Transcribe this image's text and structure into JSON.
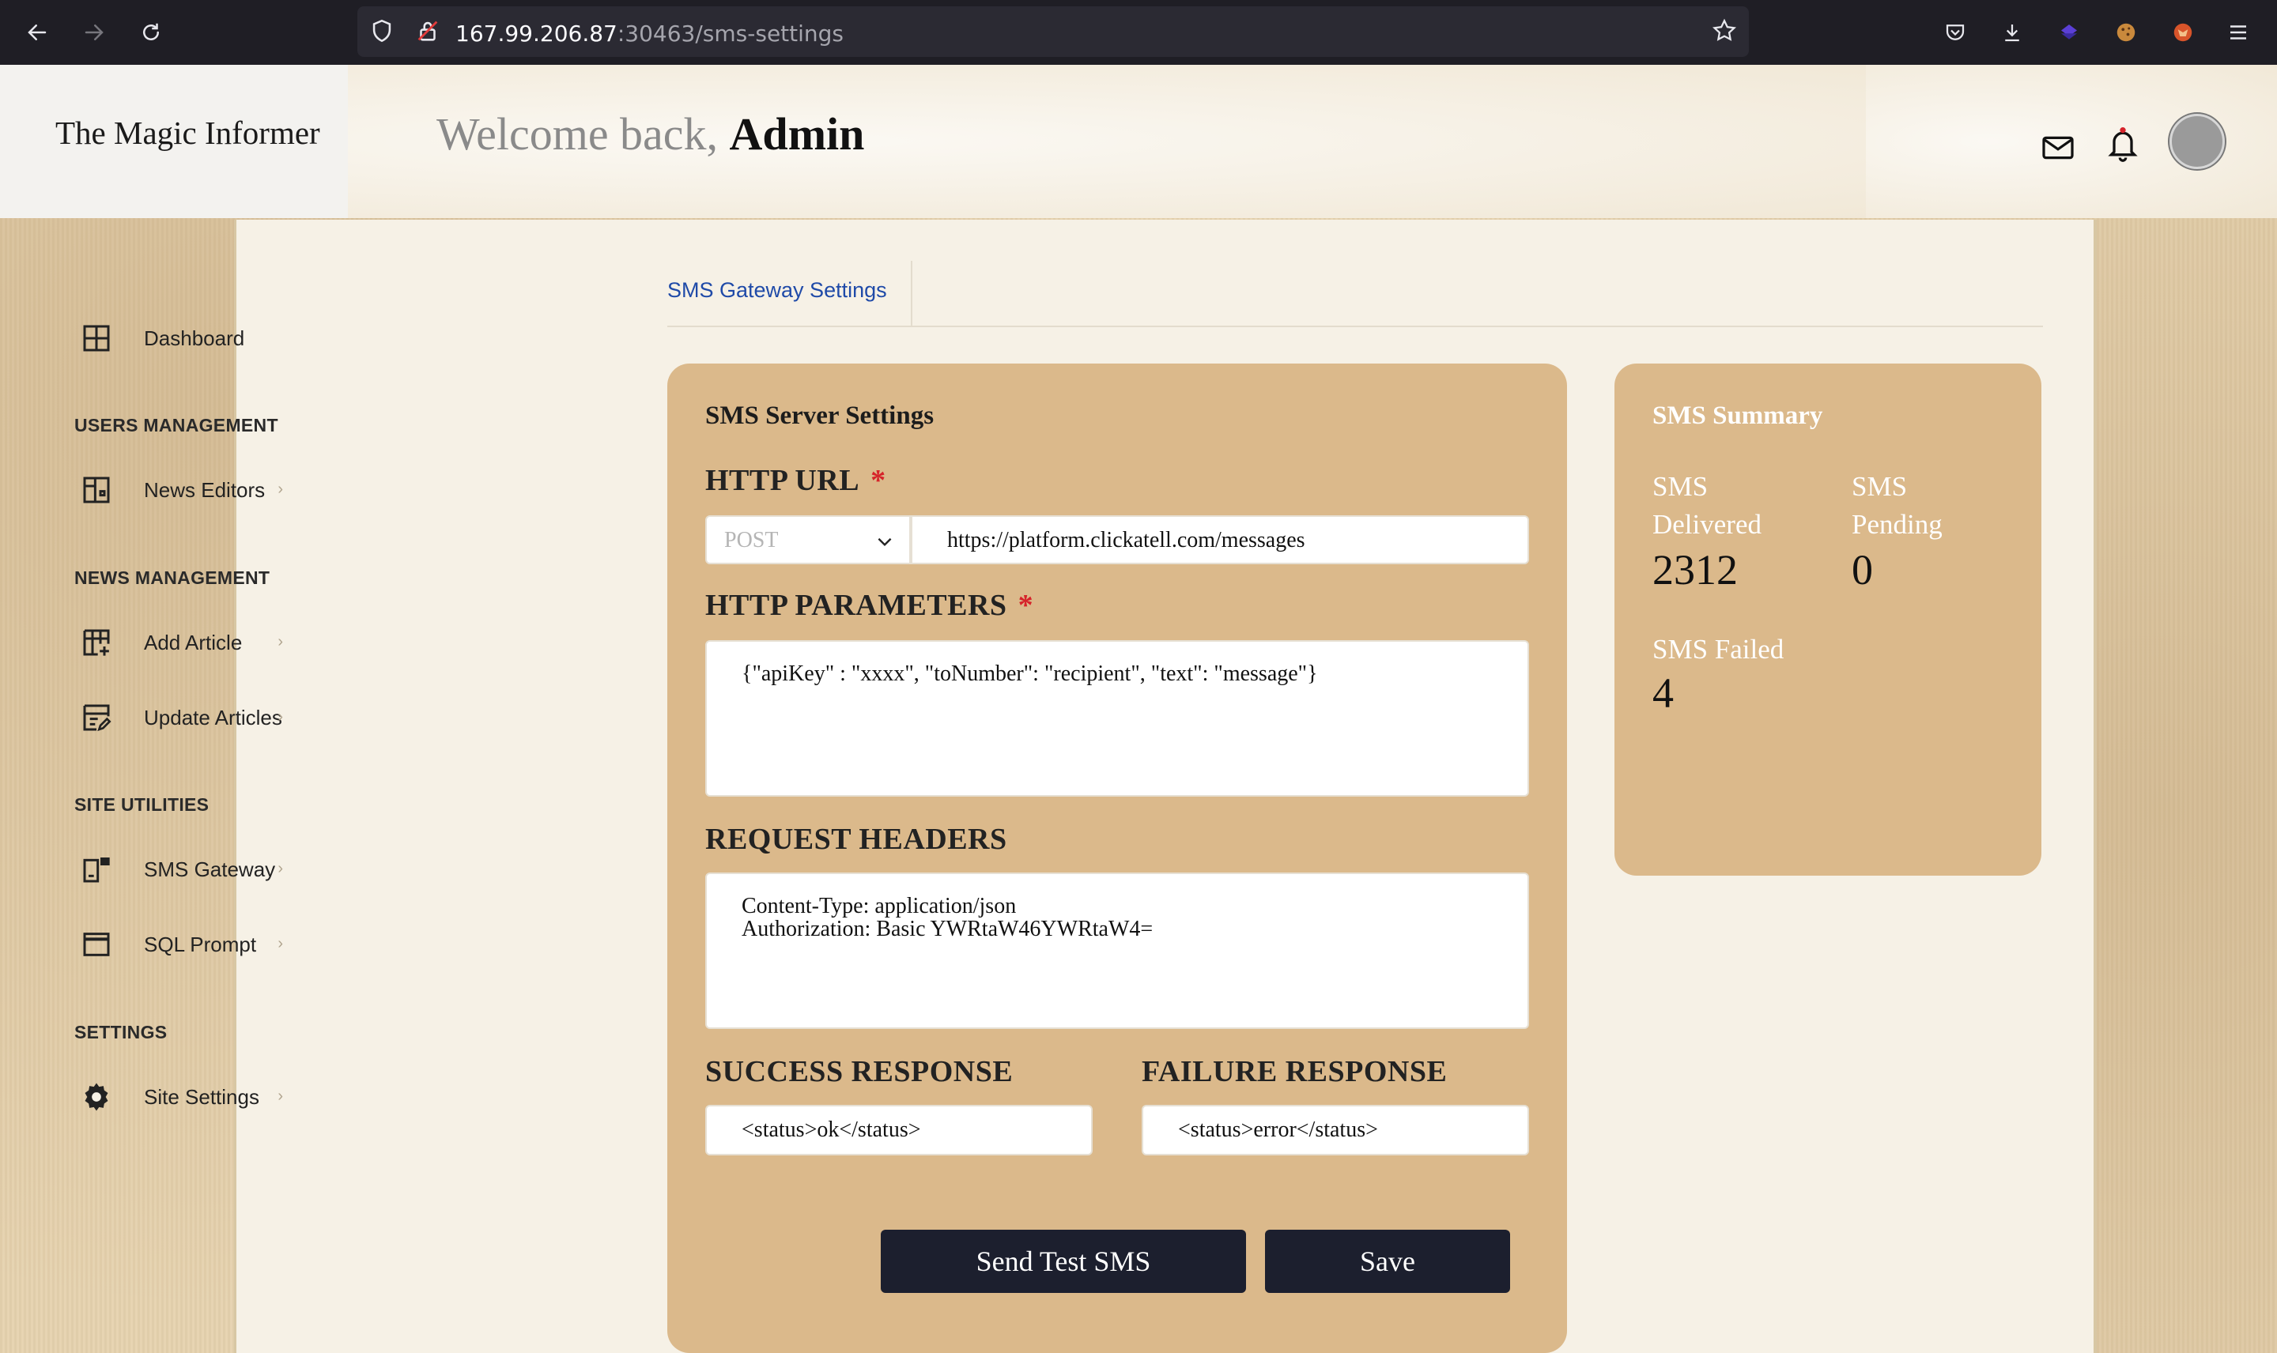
{
  "browser": {
    "url_host": "167.99.206.87",
    "url_path": ":30463/sms-settings"
  },
  "header": {
    "brand": "The Magic Informer",
    "welcome_prefix": "Welcome back,",
    "welcome_user": "Admin"
  },
  "sidebar": {
    "dashboard": "Dashboard",
    "users_section": "USERS MANAGEMENT",
    "news_editors": "News Editors",
    "news_section": "NEWS MANAGEMENT",
    "add_article": "Add Article",
    "update_articles": "Update Articles",
    "utilities_section": "SITE UTILITIES",
    "sms_gateway": "SMS Gateway",
    "sql_prompt": "SQL Prompt",
    "settings_section": "SETTINGS",
    "site_settings": "Site Settings",
    "chevron": "›"
  },
  "tabs": {
    "sms_gateway_settings": "SMS Gateway Settings"
  },
  "server_settings": {
    "title": "SMS Server Settings",
    "http_url_label": "HTTP URL",
    "required_mark": "*",
    "method": "POST",
    "url": "https://platform.clickatell.com/messages",
    "http_params_label": "HTTP PARAMETERS",
    "http_params": "{\"apiKey\" : \"xxxx\", \"toNumber\": \"recipient\", \"text\": \"message\"}",
    "request_headers_label": "REQUEST HEADERS",
    "request_headers": "Content-Type: application/json\nAuthorization: Basic YWRtaW46YWRtaW4=",
    "success_label": "SUCCESS RESPONSE",
    "success_value": "<status>ok</status>",
    "failure_label": "FAILURE RESPONSE",
    "failure_value": "<status>error</status>",
    "send_test_button": "Send Test SMS",
    "save_button": "Save"
  },
  "summary": {
    "title": "SMS Summary",
    "delivered_label": "SMS\nDelivered",
    "delivered_value": "2312",
    "pending_label": "SMS\nPending",
    "pending_value": "0",
    "failed_label": "SMS Failed",
    "failed_value": "4"
  },
  "colors": {
    "card_bg": "#dbb98b",
    "button_bg": "#1c1f2e",
    "tab_link": "#1f4aa8",
    "required": "#d6232a"
  }
}
